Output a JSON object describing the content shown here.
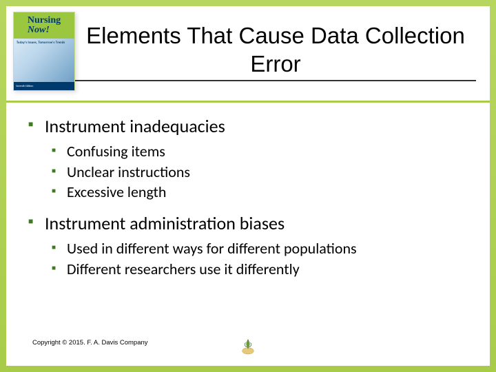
{
  "book": {
    "title_main": "Nursing",
    "title_now": "Now!",
    "subtitle": "Today's Issues, Tomorrow's Trends",
    "edition": "Seventh Edition"
  },
  "slide": {
    "title": "Elements That Cause Data Collection Error"
  },
  "bullets": [
    {
      "text": "Instrument inadequacies",
      "sub": [
        "Confusing items",
        "Unclear instructions",
        "Excessive length"
      ]
    },
    {
      "text": "Instrument administration biases",
      "sub": [
        "Used in different ways for different populations",
        "Different researchers use it differently"
      ]
    }
  ],
  "copyright": "Copyright © 2015. F. A. Davis Company"
}
